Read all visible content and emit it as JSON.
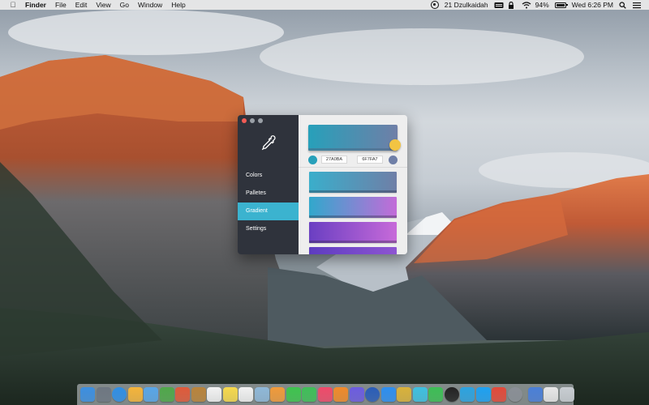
{
  "menubar": {
    "apple_icon": "apple-icon",
    "app_name": "Finder",
    "menus": [
      "File",
      "Edit",
      "View",
      "Go",
      "Window",
      "Help"
    ],
    "status_text": "21 Dzulkaidah",
    "battery_percent": "94%",
    "clock": "Wed 6:26 PM"
  },
  "app": {
    "nav": [
      {
        "label": "Colors",
        "active": false
      },
      {
        "label": "Palletes",
        "active": false
      },
      {
        "label": "Gradient",
        "active": true
      },
      {
        "label": "Settings",
        "active": false
      }
    ],
    "accent_color": "#3BB3CF",
    "sidebar_color": "#2F333C",
    "gradient": {
      "start_hex": "27A0BA",
      "end_hex": "6F7FA7",
      "start_color": "#27A0BA",
      "end_color": "#6F7FA7"
    },
    "add_button_color": "#F2C443",
    "saved_gradients": [
      {
        "from": "#3aaecb",
        "to": "#6f7fa7"
      },
      {
        "from": "#31a8cc",
        "to": "#c36bd8"
      },
      {
        "from": "#6a3fc2",
        "to": "#c76ad9"
      },
      {
        "from": "#5d3cc0",
        "to": "#8e55d2"
      }
    ]
  },
  "dock": {
    "icons": [
      {
        "name": "finder-icon",
        "color": "#3c8fe0"
      },
      {
        "name": "launchpad-icon",
        "color": "#6e7782"
      },
      {
        "name": "safari-icon",
        "color": "#2f8fe6"
      },
      {
        "name": "sketch-icon",
        "color": "#f4b43a"
      },
      {
        "name": "folder-icon",
        "color": "#58a6e8"
      },
      {
        "name": "leaf-icon",
        "color": "#4fa84a"
      },
      {
        "name": "sequel-icon",
        "color": "#e05a3a"
      },
      {
        "name": "notes-brown-icon",
        "color": "#b9843b"
      },
      {
        "name": "calendar-icon",
        "color": "#f3f3f3"
      },
      {
        "name": "stickies-icon",
        "color": "#f6d94c"
      },
      {
        "name": "reminders-icon",
        "color": "#f2f2f2"
      },
      {
        "name": "preview-icon",
        "color": "#8fb8d8"
      },
      {
        "name": "photos-icon",
        "color": "#f09a3a"
      },
      {
        "name": "messages-icon",
        "color": "#3ec44e"
      },
      {
        "name": "facetime-icon",
        "color": "#3fbf58"
      },
      {
        "name": "music-icon",
        "color": "#f04a6a"
      },
      {
        "name": "books-icon",
        "color": "#f08a2a"
      },
      {
        "name": "app-dock-icon",
        "color": "#6c5ce0"
      },
      {
        "name": "compass-icon",
        "color": "#2a5db8"
      },
      {
        "name": "app-store-icon",
        "color": "#2d8ff0"
      },
      {
        "name": "coins-icon",
        "color": "#d9b23a"
      },
      {
        "name": "ai-icon",
        "color": "#3ec0e0"
      },
      {
        "name": "whatsapp-icon",
        "color": "#3dbe55"
      },
      {
        "name": "terminal-icon",
        "color": "#222222"
      },
      {
        "name": "telegram-icon",
        "color": "#2ca3e0"
      },
      {
        "name": "twitter-icon",
        "color": "#1da1f2"
      },
      {
        "name": "s-app-icon",
        "color": "#e24a3a"
      },
      {
        "name": "system-prefs-icon",
        "color": "#8a8f96"
      },
      {
        "name": "upload-icon",
        "color": "#4a7fd8"
      },
      {
        "name": "document-icon",
        "color": "#e8e8e8"
      },
      {
        "name": "trash-icon",
        "color": "#c8cdd2"
      }
    ]
  }
}
